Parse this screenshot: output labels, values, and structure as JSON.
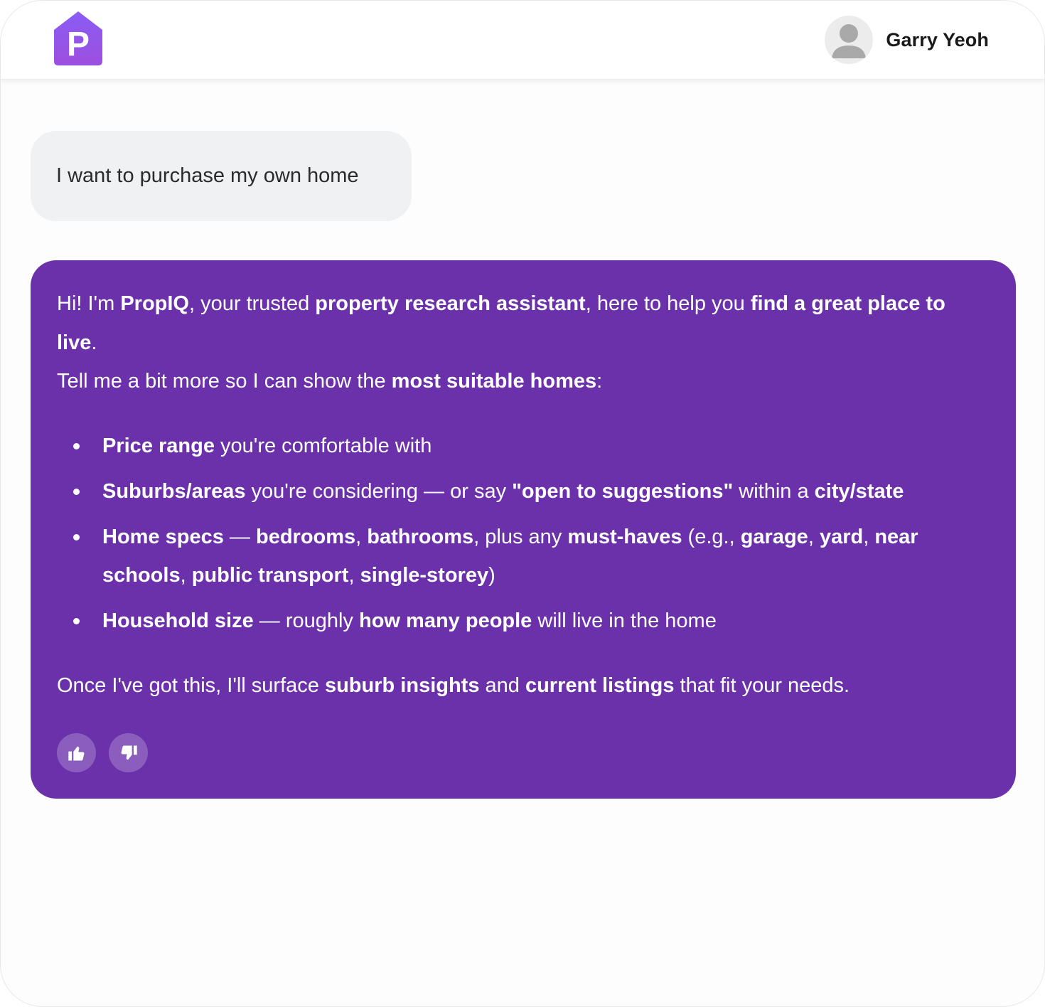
{
  "header": {
    "logo_letter": "P",
    "user_name": "Garry Yeoh"
  },
  "colors": {
    "brand_purple": "#6b31ab",
    "logo_gradient_top": "#8b5cf6",
    "logo_gradient_bottom": "#9b4de0",
    "user_bubble_bg": "#f0f1f3"
  },
  "conversation": {
    "user_message": "I want to purchase my own home",
    "assistant": {
      "intro": [
        {
          "t": "Hi! I'm ",
          "b": false
        },
        {
          "t": "PropIQ",
          "b": true
        },
        {
          "t": ", your trusted ",
          "b": false
        },
        {
          "t": "property research assistant",
          "b": true
        },
        {
          "t": ", here to help you ",
          "b": false
        },
        {
          "t": "find a great place to live",
          "b": true
        },
        {
          "t": ".",
          "b": false
        }
      ],
      "prompt": [
        {
          "t": "Tell me a bit more so I can show the ",
          "b": false
        },
        {
          "t": "most suitable homes",
          "b": true
        },
        {
          "t": ":",
          "b": false
        }
      ],
      "bullets": [
        [
          {
            "t": "Price range",
            "b": true
          },
          {
            "t": " you're comfortable with",
            "b": false
          }
        ],
        [
          {
            "t": "Suburbs/areas",
            "b": true
          },
          {
            "t": " you're considering — or say ",
            "b": false
          },
          {
            "t": "\"open to suggestions\"",
            "b": true
          },
          {
            "t": " within a ",
            "b": false
          },
          {
            "t": "city/state",
            "b": true
          }
        ],
        [
          {
            "t": "Home specs",
            "b": true
          },
          {
            "t": " — ",
            "b": false
          },
          {
            "t": "bedrooms",
            "b": true
          },
          {
            "t": ", ",
            "b": false
          },
          {
            "t": "bathrooms",
            "b": true
          },
          {
            "t": ", plus any ",
            "b": false
          },
          {
            "t": "must-haves",
            "b": true
          },
          {
            "t": " (e.g., ",
            "b": false
          },
          {
            "t": "garage",
            "b": true
          },
          {
            "t": ", ",
            "b": false
          },
          {
            "t": "yard",
            "b": true
          },
          {
            "t": ", ",
            "b": false
          },
          {
            "t": "near schools",
            "b": true
          },
          {
            "t": ", ",
            "b": false
          },
          {
            "t": "public transport",
            "b": true
          },
          {
            "t": ", ",
            "b": false
          },
          {
            "t": "single-storey",
            "b": true
          },
          {
            "t": ")",
            "b": false
          }
        ],
        [
          {
            "t": "Household size",
            "b": true
          },
          {
            "t": " — roughly ",
            "b": false
          },
          {
            "t": "how many people",
            "b": true
          },
          {
            "t": " will live in the home",
            "b": false
          }
        ]
      ],
      "closing": [
        {
          "t": "Once I've got this, I'll surface ",
          "b": false
        },
        {
          "t": "suburb insights",
          "b": true
        },
        {
          "t": " and ",
          "b": false
        },
        {
          "t": "current listings",
          "b": true
        },
        {
          "t": " that fit your needs.",
          "b": false
        }
      ],
      "feedback": {
        "like_icon": "thumbs-up-icon",
        "dislike_icon": "thumbs-down-icon"
      }
    }
  }
}
